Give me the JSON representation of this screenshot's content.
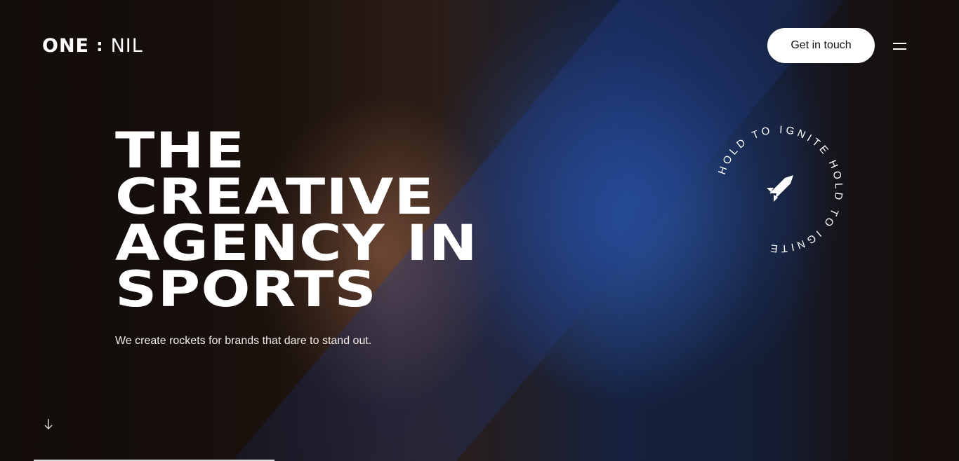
{
  "logo": {
    "one": "ONE",
    "colon": ":",
    "nil": "NIL"
  },
  "header": {
    "cta_label": "Get in touch",
    "menu_icon": "hamburger-icon"
  },
  "hero": {
    "headline_lines": [
      "THE",
      "CREATIVE",
      "AGENCY IN",
      "SPORTS"
    ],
    "tagline": "We create rockets for brands that dare to stand out."
  },
  "ignite_badge": {
    "ring_text": "HOLD TO IGNITE HOLD TO IGNITE",
    "icon": "rocket-icon"
  },
  "scroll": {
    "icon": "arrow-down-icon"
  },
  "colors": {
    "accent": "#ffffff",
    "background": "#1a120f",
    "blue_light": "#2a4fa0"
  }
}
